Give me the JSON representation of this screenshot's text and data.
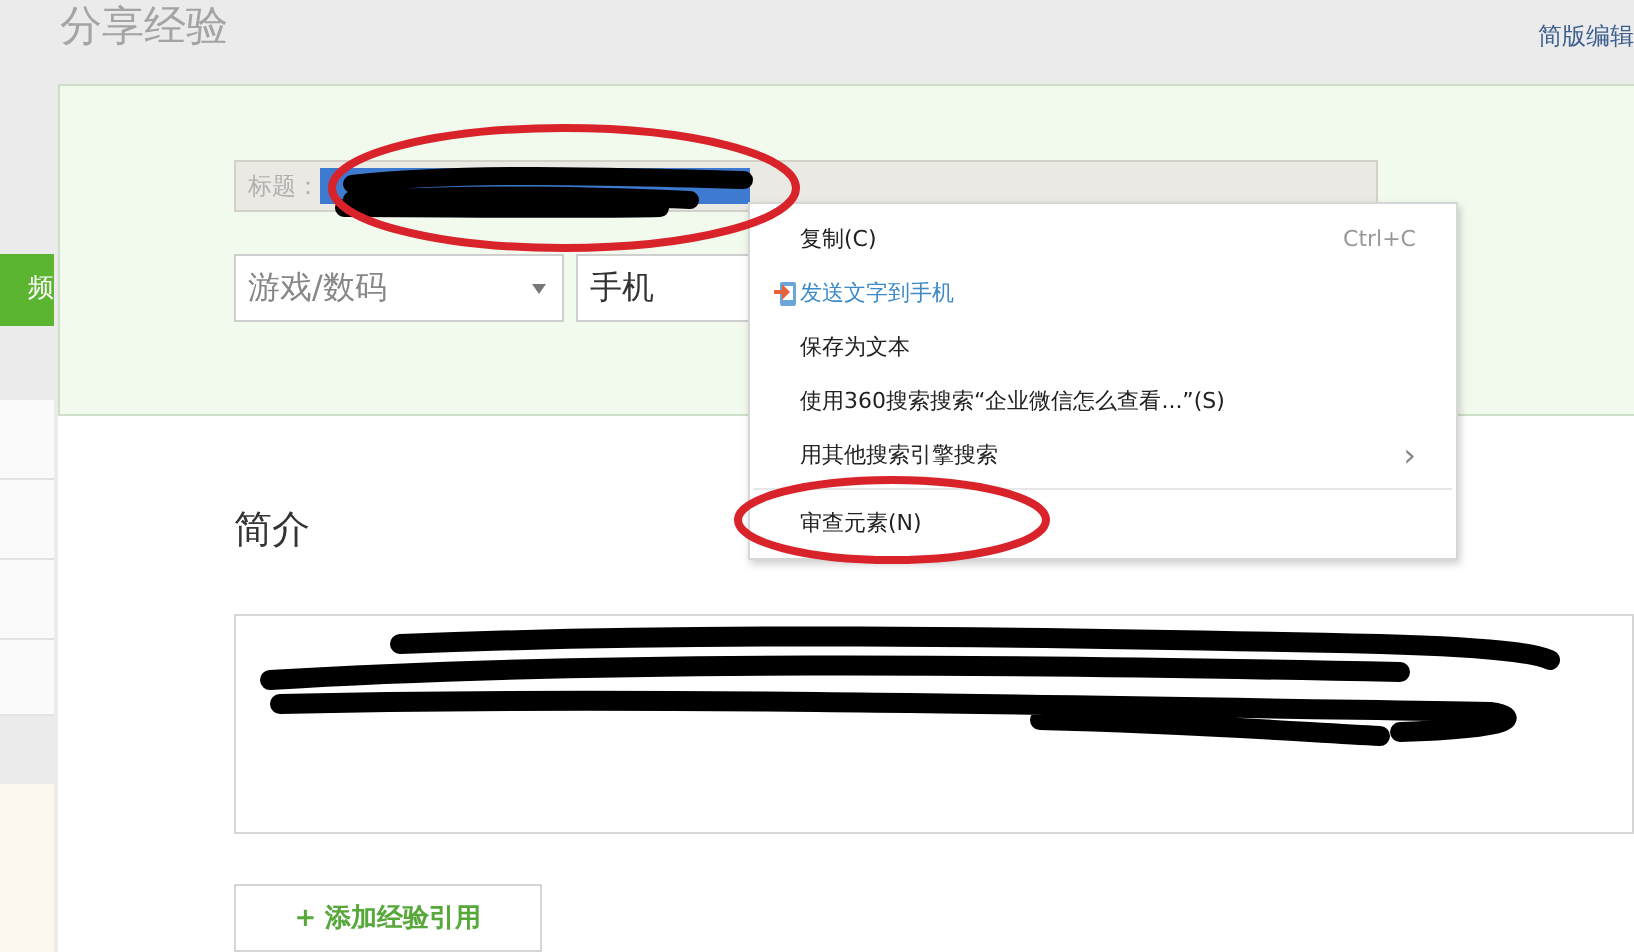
{
  "page": {
    "heading": "分享经验",
    "top_link": "简版编辑"
  },
  "sidebar": {
    "tab": "频"
  },
  "form": {
    "title_label": "标题：",
    "category": "游戏/数码",
    "subcategory": "手机",
    "intro_heading": "简介",
    "add_reference_button": "+ 添加经验引用"
  },
  "context_menu": {
    "items": [
      {
        "kind": "command",
        "label": "复制(C)",
        "shortcut": "Ctrl+C"
      },
      {
        "kind": "send",
        "label": "发送文字到手机"
      },
      {
        "kind": "command",
        "label": "保存为文本"
      },
      {
        "kind": "command",
        "label": "使用360搜索搜索“企业微信怎么查看...”(S)"
      },
      {
        "kind": "submenu",
        "label": "用其他搜索引擎搜索",
        "arrow": "›"
      },
      {
        "kind": "divider"
      },
      {
        "kind": "command",
        "label": "审查元素(N)"
      }
    ]
  }
}
